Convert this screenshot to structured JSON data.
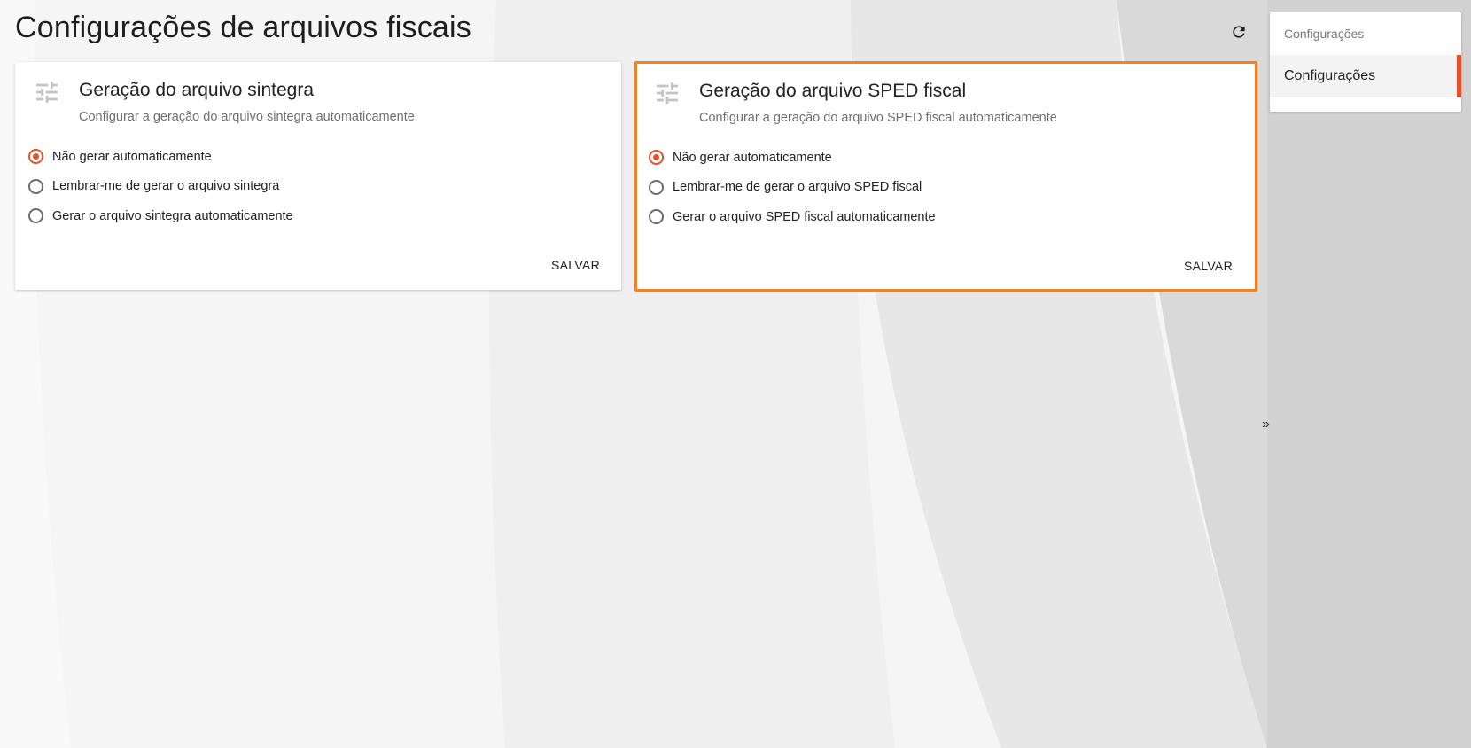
{
  "page": {
    "title": "Configurações de arquivos fiscais"
  },
  "toolbar": {
    "refresh_icon": "refresh-icon"
  },
  "cards": [
    {
      "title": "Geração do arquivo sintegra",
      "subtitle": "Configurar a geração do arquivo sintegra automaticamente",
      "icon": "tune-icon",
      "options": [
        {
          "label": "Não gerar automaticamente",
          "selected": true
        },
        {
          "label": "Lembrar-me de gerar o arquivo sintegra",
          "selected": false
        },
        {
          "label": "Gerar o arquivo sintegra automaticamente",
          "selected": false
        }
      ],
      "save_label": "SALVAR"
    },
    {
      "title": "Geração do arquivo SPED fiscal",
      "subtitle": "Configurar a geração do arquivo SPED fiscal automaticamente",
      "icon": "tune-icon",
      "options": [
        {
          "label": "Não gerar automaticamente",
          "selected": true
        },
        {
          "label": "Lembrar-me de gerar o arquivo SPED fiscal",
          "selected": false
        },
        {
          "label": "Gerar o arquivo SPED fiscal automaticamente",
          "selected": false
        }
      ],
      "save_label": "SALVAR"
    }
  ],
  "side_panel": {
    "header": "Configurações",
    "items": [
      {
        "label": "Configurações",
        "active": true
      }
    ]
  },
  "collapse": {
    "label": "»"
  },
  "colors": {
    "accent": "#e8502a",
    "highlight_border": "#f58025"
  }
}
